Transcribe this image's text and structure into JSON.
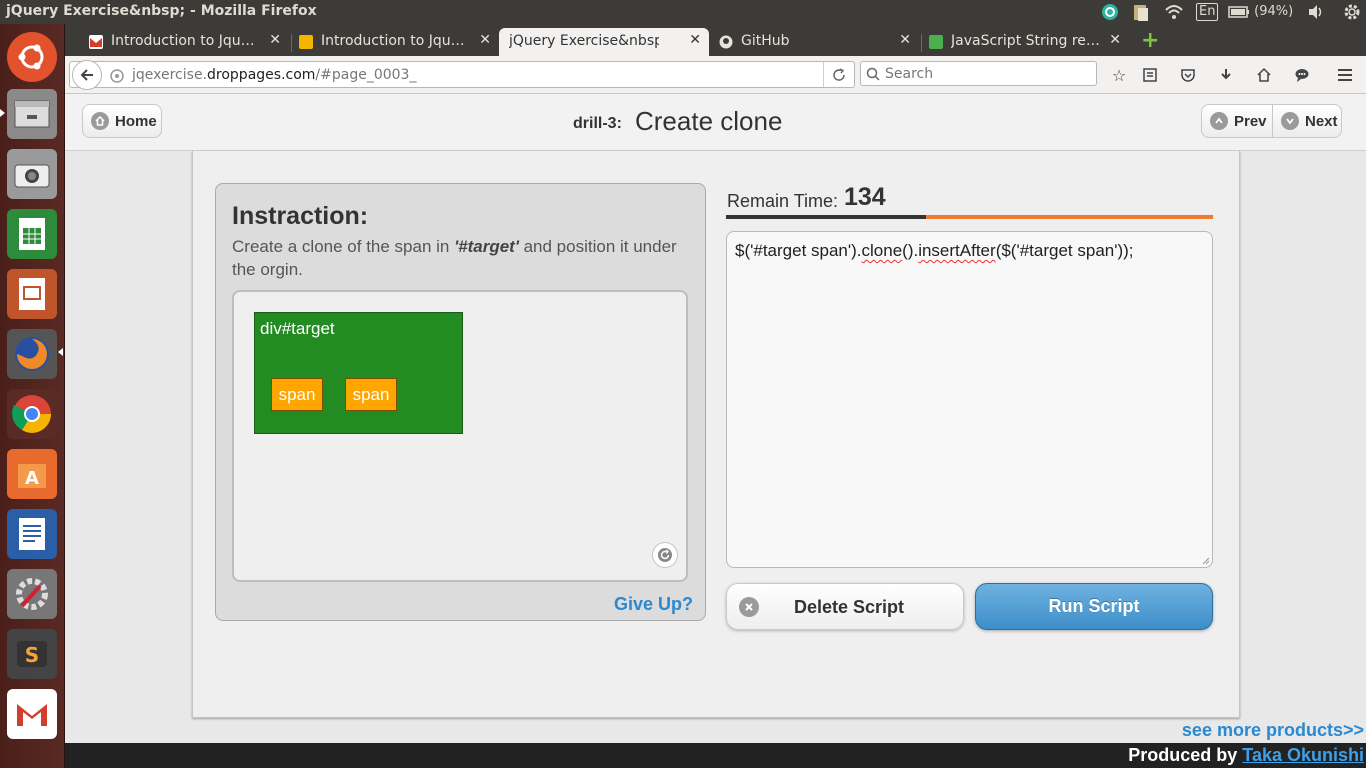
{
  "window": {
    "title": "jQuery Exercise&nbsp; - Mozilla Firefox"
  },
  "tray": {
    "keyboard": "En",
    "battery": "(94%)"
  },
  "tabs": [
    {
      "label": "Introduction to Jqu…",
      "icon": "gmail-icon"
    },
    {
      "label": "Introduction to Jqu…",
      "icon": "slides-icon"
    },
    {
      "label": "jQuery Exercise&nbsp;",
      "icon": "none"
    },
    {
      "label": "GitHub",
      "icon": "github-icon"
    },
    {
      "label": "JavaScript String re…",
      "icon": "w3-icon"
    }
  ],
  "navbar": {
    "url_prefix": "jqexercise.",
    "url_host": "droppages.com",
    "url_path": "/#page_0003_",
    "search_placeholder": "Search"
  },
  "header": {
    "home_label": "Home",
    "drill_label": "drill-3:",
    "title": "Create clone",
    "prev_label": "Prev",
    "next_label": "Next"
  },
  "instruction": {
    "heading": "Instraction:",
    "text_before": "Create a clone of the span in ",
    "text_target": "'#target'",
    "text_after": " and position it under the orgin.",
    "demo": {
      "target_label": "div#target",
      "spans": [
        "span",
        "span"
      ]
    },
    "give_up": "Give Up?"
  },
  "timer": {
    "label": "Remain Time:",
    "value": "134",
    "remaining_fraction": 0.59
  },
  "editor": {
    "code": "$('#target span').clone().insertAfter($('#target span'));"
  },
  "buttons": {
    "delete_label": "Delete Script",
    "run_label": "Run Script"
  },
  "footer": {
    "more": "see more products>>",
    "produced_by": "Produced by ",
    "author": "Taka Okunishi"
  },
  "colors": {
    "target_bg": "#228b22",
    "span_bg": "#ffa500",
    "accent_blue": "#2a89d0",
    "timer_orange": "#f07a2e"
  }
}
